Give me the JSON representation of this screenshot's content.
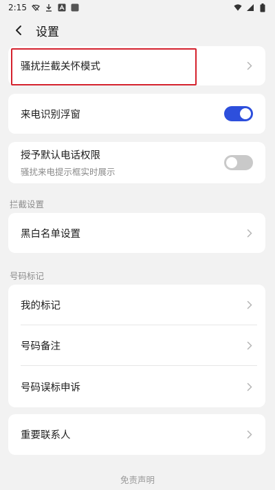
{
  "status_bar": {
    "time": "2:15",
    "icons_left": [
      "vpn-icon",
      "download-icon",
      "a-icon",
      "square-icon"
    ],
    "icons_right": [
      "wifi-icon",
      "signal-icon",
      "battery-icon"
    ]
  },
  "header": {
    "title": "设置"
  },
  "card1": {
    "row1": {
      "label": "骚扰拦截关怀模式"
    }
  },
  "card2": {
    "label": "来电识别浮窗",
    "switch_on": true
  },
  "card3": {
    "label": "授予默认电话权限",
    "sub": "骚扰来电提示框实时展示",
    "switch_on": false
  },
  "section_block": {
    "label": "拦截设置",
    "row": {
      "label": "黑白名单设置"
    }
  },
  "section_mark": {
    "label": "号码标记",
    "rows": [
      {
        "label": "我的标记"
      },
      {
        "label": "号码备注"
      },
      {
        "label": "号码误标申诉"
      }
    ]
  },
  "card_contacts": {
    "label": "重要联系人"
  },
  "footer": {
    "disclaimer": "免责声明"
  },
  "colors": {
    "accent": "#2d4fdc",
    "highlight_border": "#d4202c",
    "background": "#f2f2f2"
  }
}
